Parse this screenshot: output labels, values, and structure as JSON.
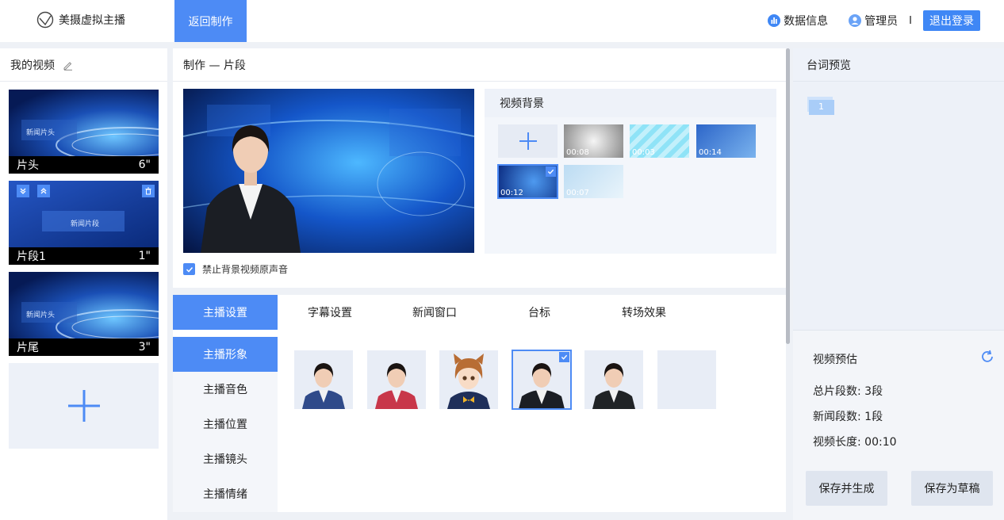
{
  "app": {
    "name": "美摄虚拟主播",
    "nav_back": "返回制作",
    "data_info": "数据信息",
    "admin": "管理员",
    "separator": "I",
    "logout": "退出登录"
  },
  "left": {
    "title": "我的视频",
    "clips": [
      {
        "name": "片头",
        "duration": "6\"",
        "overlay": "新闻片头"
      },
      {
        "name": "片段1",
        "duration": "1\"",
        "overlay": "新闻片段"
      },
      {
        "name": "片尾",
        "duration": "3\"",
        "overlay": "新闻片头"
      }
    ]
  },
  "center": {
    "title": "制作 — 片段",
    "mute_label": "禁止背景视频原声音",
    "bg_title": "视频背景",
    "backgrounds": [
      {
        "duration": "00:08"
      },
      {
        "duration": "00:03"
      },
      {
        "duration": "00:14"
      },
      {
        "duration": "00:12",
        "selected": true
      },
      {
        "duration": "00:07"
      }
    ],
    "tabs": [
      "主播设置",
      "字幕设置",
      "新闻窗口",
      "台标",
      "转场效果"
    ],
    "side_menu": [
      "主播形象",
      "主播音色",
      "主播位置",
      "主播镜头",
      "主播情绪"
    ]
  },
  "right": {
    "title": "台词预览",
    "page_number": "1",
    "estimate_title": "视频预估",
    "total_segments": "总片段数: 3段",
    "news_segments": "新闻段数: 1段",
    "video_length": "视频长度: 00:10",
    "save_generate": "保存并生成",
    "save_draft": "保存为草稿"
  },
  "colors": {
    "accent": "#4d8bf5",
    "panel_bg": "#edf1f8"
  }
}
